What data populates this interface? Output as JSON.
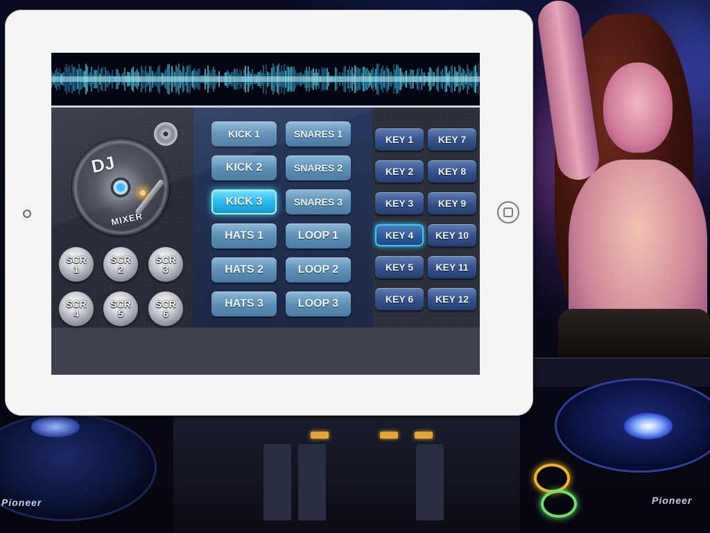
{
  "wave": {
    "name": "waveform-banner"
  },
  "turntable": {
    "title": "DJ",
    "subtitle": "MIXER"
  },
  "scratch_buttons": [
    {
      "label": "SCR\n1"
    },
    {
      "label": "SCR\n2"
    },
    {
      "label": "SCR\n3"
    },
    {
      "label": "SCR\n4"
    },
    {
      "label": "SCR\n5"
    },
    {
      "label": "SCR\n6"
    }
  ],
  "pads": {
    "col1": [
      "KICK 1",
      "KICK 2",
      "KICK 3",
      "HATS 1",
      "HATS 2",
      "HATS 3"
    ],
    "col2": [
      "SNARES 1",
      "SNARES 2",
      "SNARES 3",
      "LOOP 1",
      "LOOP 2",
      "LOOP 3"
    ],
    "active": "KICK 3"
  },
  "keys": {
    "col1": [
      "KEY 1",
      "KEY 2",
      "KEY 3",
      "KEY 4",
      "KEY 5",
      "KEY 6"
    ],
    "col2": [
      "KEY 7",
      "KEY 8",
      "KEY 9",
      "KEY 10",
      "KEY 11",
      "KEY 12"
    ],
    "active": "KEY 4"
  },
  "background": {
    "brand_left": "Pioneer",
    "brand_right": "Pioneer"
  },
  "colors": {
    "accent": "#3ad6ff",
    "pad": "#5e8fb5",
    "key": "#34508a"
  }
}
